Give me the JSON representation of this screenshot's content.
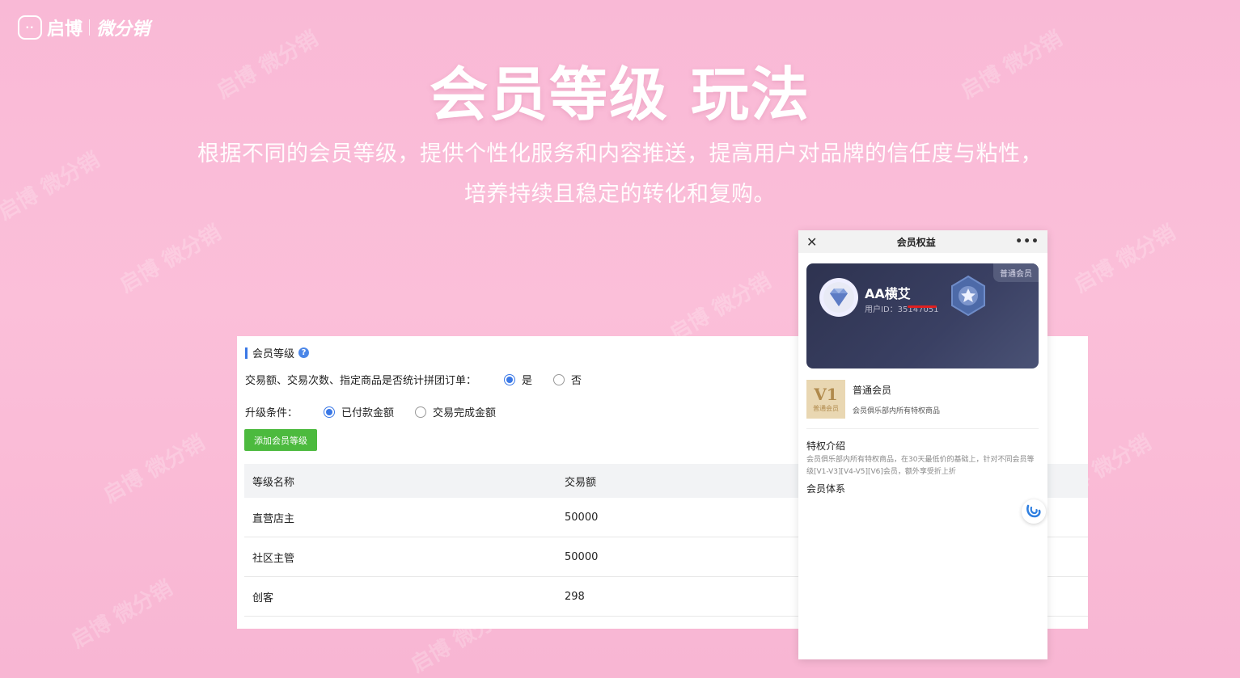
{
  "logo": {
    "badge": "··",
    "brand": "启博",
    "product": "微分销"
  },
  "watermark": "启博 微分销",
  "hero": {
    "title": "会员等级 玩法",
    "subtitle_line1": "根据不同的会员等级，提供个性化服务和内容推送，提高用户对品牌的信任度与粘性，",
    "subtitle_line2": "培养持续且稳定的转化和复购。"
  },
  "panel": {
    "title": "会员等级",
    "group_question": "交易额、交易次数、指定商品是否统计拼团订单：",
    "group_options": [
      "是",
      "否"
    ],
    "group_selected": "是",
    "upgrade_label": "升级条件：",
    "upgrade_options": [
      "已付款金额",
      "交易完成金额"
    ],
    "upgrade_selected": "已付款金额",
    "add_button": "添加会员等级",
    "table": {
      "headers": [
        "等级名称",
        "交易额"
      ],
      "rows": [
        [
          "直营店主",
          "50000"
        ],
        [
          "社区主管",
          "50000"
        ],
        [
          "创客",
          "298"
        ]
      ]
    }
  },
  "phone": {
    "title": "会员权益",
    "card": {
      "tag": "普通会员",
      "name": "AA横艾",
      "user_id": "用户ID：35147051"
    },
    "level": {
      "badge_big": "V1",
      "badge_small": "普通会员",
      "name": "普通会员",
      "desc": "会员俱乐部内所有特权商品"
    },
    "privilege_title": "特权介绍",
    "privilege_desc": "会员俱乐部内所有特权商品，在30天最低价的基础上，针对不同会员等级[V1-V3][V4-V5][V6]会员，额外享受折上折",
    "system_title": "会员体系"
  },
  "colors": {
    "background": "#fbbfd9",
    "accent": "#3a78e6",
    "button": "#4cba3e",
    "card": "#2e3350"
  }
}
